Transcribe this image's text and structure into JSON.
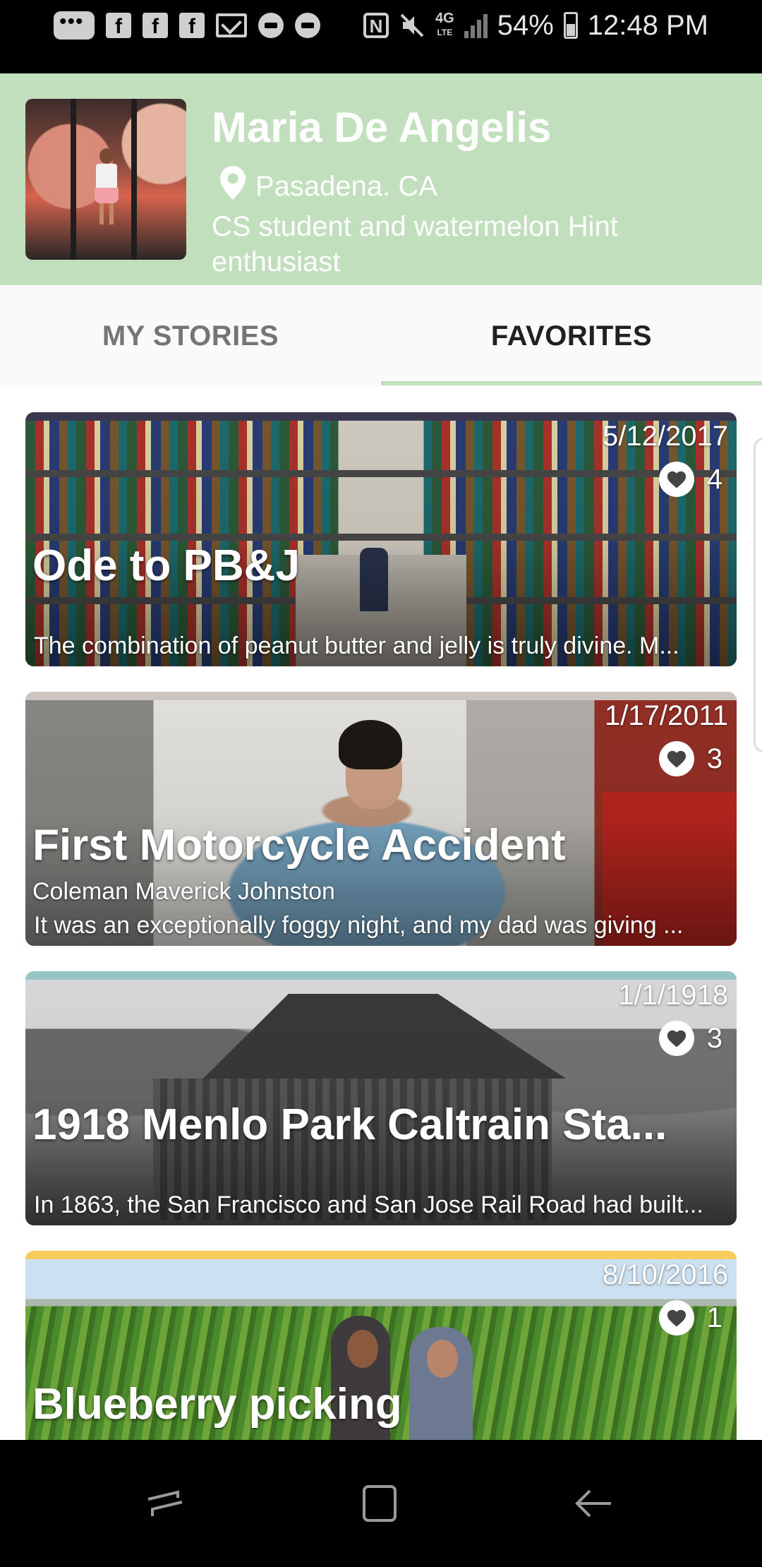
{
  "status_bar": {
    "left_icons": [
      "message-icon",
      "facebook-icon",
      "facebook-icon",
      "facebook-icon",
      "gmail-icon",
      "record-icon",
      "record-icon"
    ],
    "right_icons": [
      "nfc-icon",
      "mute-icon",
      "4g-lte-icon",
      "signal-icon"
    ],
    "battery": "54%",
    "time": "12:48 PM"
  },
  "profile": {
    "name": "Maria De Angelis",
    "location": "Pasadena. CA",
    "bio": "CS student and watermelon Hint enthusiast"
  },
  "tabs": [
    {
      "label": "MY STORIES",
      "selected": false
    },
    {
      "label": "FAVORITES",
      "selected": true
    }
  ],
  "accent_color": "#c1dfbd",
  "stories": [
    {
      "date": "5/12/2017",
      "likes": "4",
      "title": "Ode to PB&J",
      "author": "",
      "excerpt": "The combination of peanut butter and jelly is truly divine. M...",
      "band_color": "#3d3b55"
    },
    {
      "date": "1/17/2011",
      "likes": "3",
      "title": "First Motorcycle Accident",
      "author": "Coleman Maverick Johnston",
      "excerpt": "It was an exceptionally foggy night, and my dad was giving ...",
      "band_color": "#d6d0cb"
    },
    {
      "date": "1/1/1918",
      "likes": "3",
      "title": "1918 Menlo Park Caltrain Sta...",
      "author": "",
      "excerpt": "In 1863, the San Francisco and San Jose Rail Road had built...",
      "band_color": "#9fcfcf"
    },
    {
      "date": "8/10/2016",
      "likes": "1",
      "title": "Blueberry picking",
      "author": "",
      "excerpt": "",
      "band_color": "#f6cd5d"
    }
  ],
  "nav_bar": [
    "recent-apps-icon",
    "home-icon",
    "back-icon"
  ]
}
